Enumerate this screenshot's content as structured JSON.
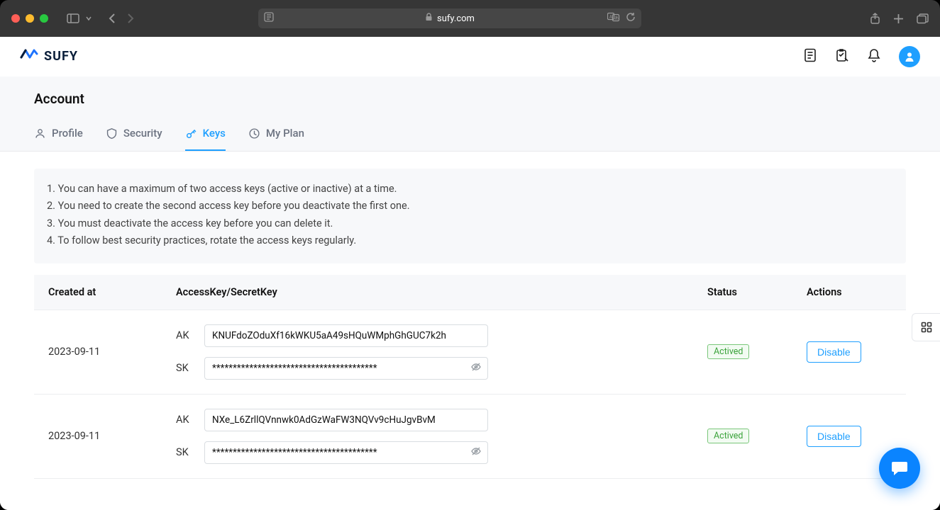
{
  "browser": {
    "url_host": "sufy.com"
  },
  "header": {
    "brand": "SUFY"
  },
  "page_title": "Account",
  "tabs": [
    {
      "label": "Profile"
    },
    {
      "label": "Security"
    },
    {
      "label": "Keys"
    },
    {
      "label": "My Plan"
    }
  ],
  "notice": {
    "l1": "1. You can have a maximum of two access keys (active or inactive) at a time.",
    "l2": "2. You need to create the second access key before you deactivate the first one.",
    "l3": "3. You must deactivate the access key before you can delete it.",
    "l4": "4. To follow best security practices, rotate the access keys regularly."
  },
  "table": {
    "headers": {
      "created": "Created at",
      "aksk": "AccessKey/SecretKey",
      "status": "Status",
      "actions": "Actions"
    },
    "labels": {
      "ak": "AK",
      "sk": "SK"
    },
    "sk_mask": "****************************************",
    "rows": [
      {
        "created": "2023-09-11",
        "ak": "KNUFdoZOduXf16kWKU5aA49sHQuWMphGhGUC7k2h",
        "status": "Actived",
        "action": "Disable"
      },
      {
        "created": "2023-09-11",
        "ak": "NXe_L6ZrllQVnnwk0AdGzWaFW3NQVv9cHuJgvBvM",
        "status": "Actived",
        "action": "Disable"
      }
    ]
  }
}
